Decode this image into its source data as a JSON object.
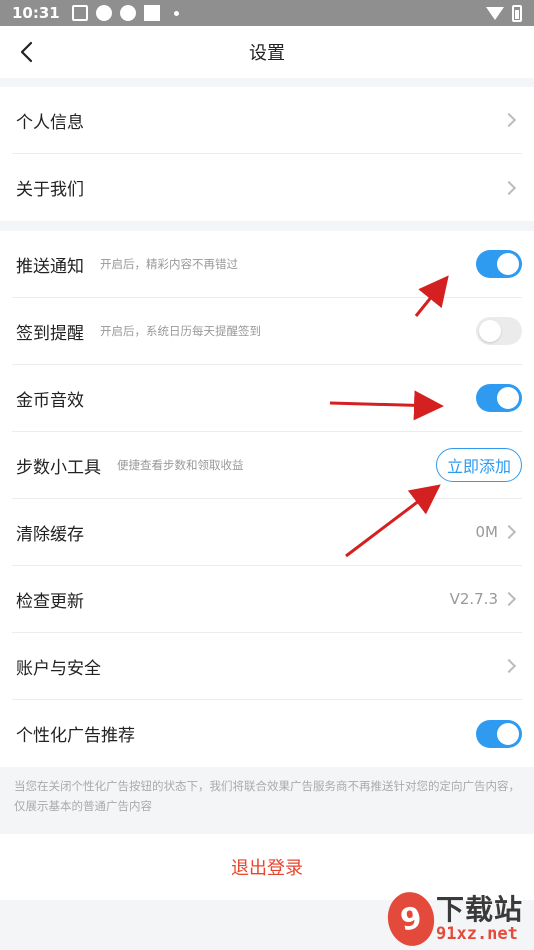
{
  "status_bar": {
    "time": "10:31"
  },
  "header": {
    "title": "设置"
  },
  "group1": [
    {
      "label": "个人信息"
    },
    {
      "label": "关于我们"
    }
  ],
  "group2": [
    {
      "label": "推送通知",
      "hint": "开启后，精彩内容不再错过",
      "toggle": "on"
    },
    {
      "label": "签到提醒",
      "hint": "开启后，系统日历每天提醒签到",
      "toggle": "off"
    },
    {
      "label": "金币音效",
      "toggle": "on"
    },
    {
      "label": "步数小工具",
      "hint": "便捷查看步数和领取收益",
      "button": "立即添加"
    },
    {
      "label": "清除缓存",
      "value": "0M"
    },
    {
      "label": "检查更新",
      "value": "V2.7.3"
    },
    {
      "label": "账户与安全"
    },
    {
      "label": "个性化广告推荐",
      "toggle": "on"
    }
  ],
  "notice": "当您在关闭个性化广告按钮的状态下，我们将联合效果广告服务商不再推送针对您的定向广告内容，仅展示基本的普通广告内容",
  "logout_label": "退出登录",
  "watermark": {
    "top": "下载站",
    "bottom": "91xz.net",
    "mark": "9"
  },
  "colors": {
    "accent": "#2e9bf0",
    "logout": "#e8452f",
    "arrow": "#d42020"
  }
}
